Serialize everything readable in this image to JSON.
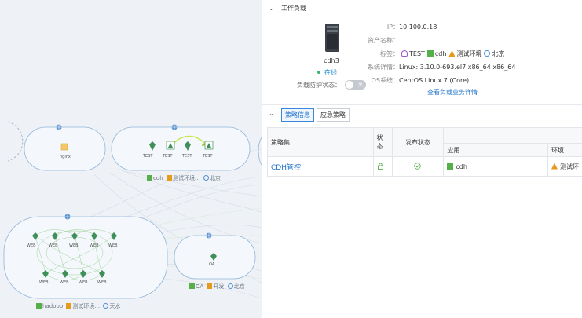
{
  "topology": {
    "groups": [
      {
        "name": "nginx-group",
        "label": "cdh 测试环境... 北京",
        "show_label": false
      },
      {
        "name": "cdh-group",
        "caption": "cdh",
        "env": "测试环境...",
        "loc": "北京"
      },
      {
        "name": "hadoop-group",
        "caption": "hadoop",
        "env": "测试环境...",
        "loc": "天水"
      },
      {
        "name": "oa-group",
        "caption": "OA",
        "env": "开发",
        "loc": "北京"
      }
    ],
    "nodes": {
      "nginx": "nginx",
      "test": "TEST",
      "web": "WEB",
      "oa": "OA"
    }
  },
  "workload": {
    "section_title": "工作负载",
    "host_name": "cdh3",
    "status": "在线",
    "guard_label": "负载防护状态：",
    "guard_toggle": "关",
    "ip_label": "IP：",
    "ip": "10.100.0.18",
    "asset_label": "资产名称：",
    "asset": "",
    "tags_label": "标签：",
    "tags": {
      "role": "TEST",
      "app": "cdh",
      "env": "测试环境",
      "loc": "北京"
    },
    "os_detail_label": "系统详情：",
    "os_detail": "Linux: 3.10.0-693.el7.x86_64 x86_64",
    "os_label": "OS系统：",
    "os": "CentOS Linux 7 (Core)",
    "detail_link": "查看负载业务详情"
  },
  "policy": {
    "tabs": [
      "策略信息",
      "应急策略"
    ],
    "active_tab": 0,
    "headers": {
      "set": "策略集",
      "state": "状态",
      "publish": "发布状态",
      "app": "应用",
      "env": "环境"
    },
    "rows": [
      {
        "set": "CDH管控",
        "app": "cdh",
        "env": "测试环"
      }
    ]
  },
  "colors": {
    "accent": "#1b6fc9",
    "online": "#3cb371",
    "group_border": "#8fb6dc",
    "link_green": "#7ac07a",
    "app_green": "#55b04a",
    "env_orange": "#e69a1c",
    "role_purple": "#9a59c9"
  }
}
